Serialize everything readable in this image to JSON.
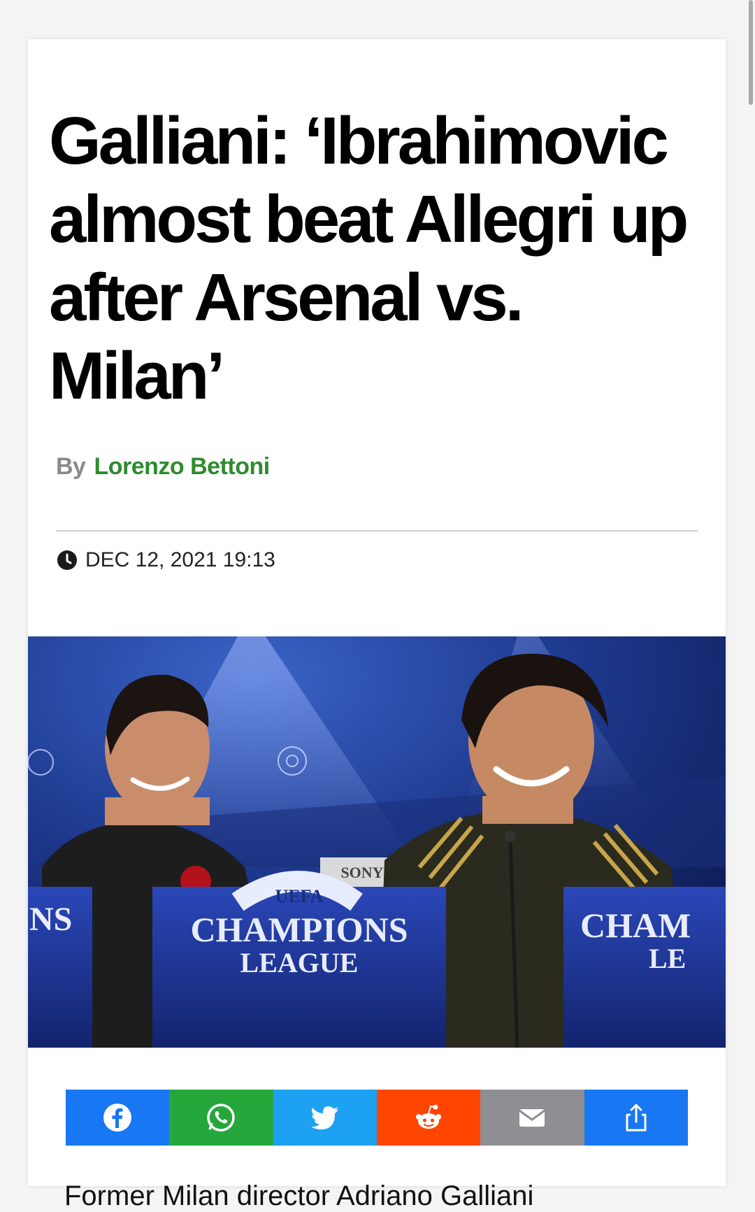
{
  "article": {
    "headline": "Galliani: ‘Ibrahimovic almost beat Allegri up after Arsenal vs. Milan’",
    "byline_prefix": "By",
    "author": "Lorenzo Bettoni",
    "date": "DEC 12, 2021 19:13",
    "body_start": "Former Milan director Adriano Galliani"
  },
  "photo": {
    "banner_text_center": "CHAMPIONS",
    "banner_subtext_center": "LEAGUE",
    "banner_arc": "UEFA",
    "banner_left_fragment": "NS",
    "banner_right_fragment": "CHAM",
    "banner_right_sub": "LE",
    "sponsor": "SONY",
    "icon": "press-conference-photo"
  },
  "share": {
    "buttons": [
      {
        "name": "facebook",
        "icon": "facebook-icon",
        "color": "#1877f2"
      },
      {
        "name": "whatsapp",
        "icon": "whatsapp-icon",
        "color": "#25a73b"
      },
      {
        "name": "twitter",
        "icon": "twitter-icon",
        "color": "#1da1f2"
      },
      {
        "name": "reddit",
        "icon": "reddit-icon",
        "color": "#ff4500"
      },
      {
        "name": "email",
        "icon": "email-icon",
        "color": "#8e8e93"
      },
      {
        "name": "share",
        "icon": "share-icon",
        "color": "#1877f2"
      }
    ]
  },
  "colors": {
    "author": "#2e8b2e",
    "byline_prefix": "#8a8a8a"
  }
}
